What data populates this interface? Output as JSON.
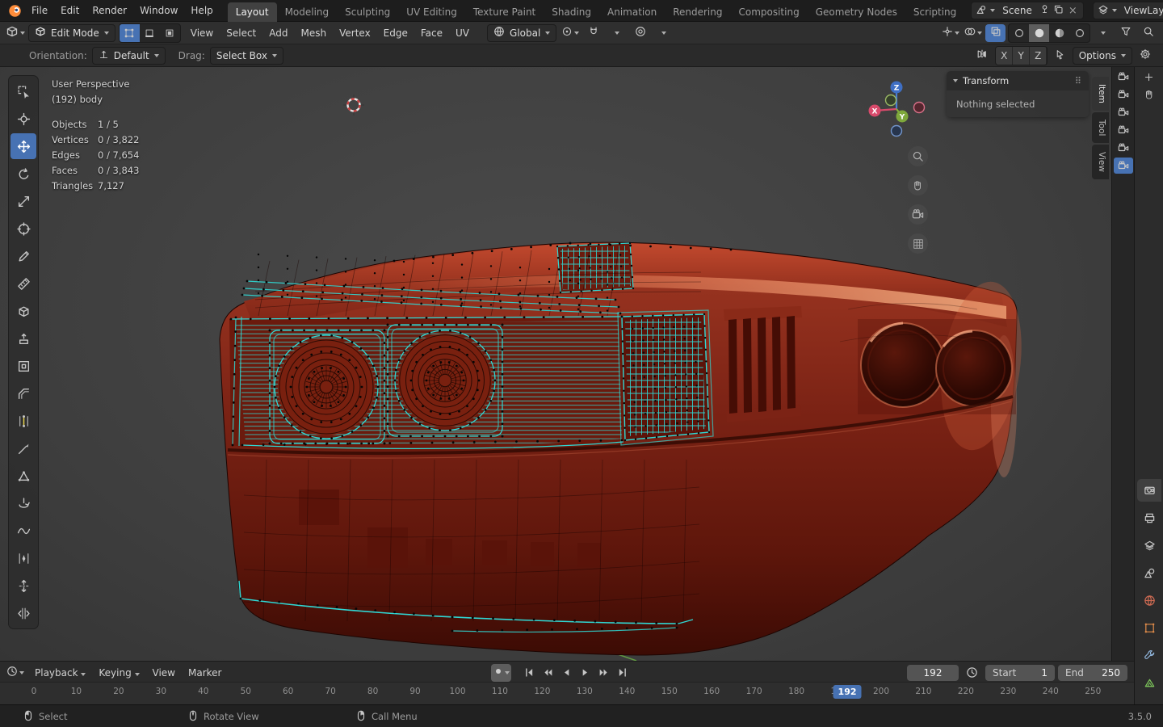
{
  "topbar": {
    "menus": [
      "File",
      "Edit",
      "Render",
      "Window",
      "Help"
    ],
    "workspaces": [
      "Layout",
      "Modeling",
      "Sculpting",
      "UV Editing",
      "Texture Paint",
      "Shading",
      "Animation",
      "Rendering",
      "Compositing",
      "Geometry Nodes",
      "Scripting"
    ],
    "active_workspace": "Layout",
    "scene_selector": {
      "label": "Scene"
    },
    "viewlayer_selector": {
      "label": "ViewLayer"
    }
  },
  "viewport_header": {
    "mode_selector": "Edit Mode",
    "select_modes": [
      "vertex",
      "edge",
      "face"
    ],
    "active_select_mode": "vertex",
    "menus": [
      "View",
      "Select",
      "Add",
      "Mesh",
      "Vertex",
      "Edge",
      "Face",
      "UV"
    ],
    "orientation": "Global",
    "shading_modes": [
      "wireframe",
      "solid",
      "material",
      "rendered"
    ],
    "active_shading_mode": "solid"
  },
  "tool_settings_bar": {
    "orientation_label": "Orientation:",
    "orientation_value": "Default",
    "drag_label": "Drag:",
    "drag_value": "Select Box",
    "axis_toggles": [
      "X",
      "Y",
      "Z"
    ],
    "options_label": "Options"
  },
  "toolbar_tools": [
    "select-box",
    "cursor",
    "move",
    "rotate",
    "scale",
    "transform",
    "annotate",
    "measure",
    "add-cube",
    "extrude-region",
    "inset-faces",
    "bevel",
    "loop-cut",
    "knife",
    "poly-build",
    "spin",
    "smooth",
    "edge-slide",
    "shrink-fatten",
    "rip-region"
  ],
  "active_tool": "move",
  "viewport": {
    "perspective_label": "User Perspective",
    "object_label": "(192) body",
    "stats": [
      {
        "label": "Objects",
        "value": "1 / 5"
      },
      {
        "label": "Vertices",
        "value": "0 / 3,822"
      },
      {
        "label": "Edges",
        "value": "0 / 7,654"
      },
      {
        "label": "Faces",
        "value": "0 / 3,843"
      },
      {
        "label": "Triangles",
        "value": "7,127"
      }
    ],
    "gizmo_axes": [
      "X",
      "Y",
      "Z"
    ],
    "sidebar_tabs": [
      "Item",
      "Tool",
      "View"
    ],
    "active_sidebar_tab": "Item",
    "transform_panel": {
      "title": "Transform",
      "message": "Nothing selected"
    }
  },
  "right_rail": {
    "outliner_camera_toggles": 6,
    "properties_tabs": [
      "render",
      "output",
      "view-layer",
      "scene",
      "world",
      "object",
      "modifiers",
      "data"
    ],
    "active_properties_tab": "render"
  },
  "timeline": {
    "menus": [
      "Playback",
      "Keying",
      "View",
      "Marker"
    ],
    "transport": [
      "jump-start",
      "prev-keyframe",
      "play-reverse",
      "play",
      "next-keyframe",
      "jump-end"
    ],
    "current_frame": "192",
    "frame_field_value": "192",
    "start_label": "Start",
    "start_value": "1",
    "end_label": "End",
    "end_value": "250",
    "ticks": [
      "0",
      "10",
      "20",
      "30",
      "40",
      "50",
      "60",
      "70",
      "80",
      "90",
      "100",
      "110",
      "120",
      "130",
      "140",
      "150",
      "160",
      "170",
      "180",
      "190",
      "200",
      "210",
      "220",
      "230",
      "240",
      "250"
    ]
  },
  "statusbar": {
    "items": [
      {
        "icon": "mouse-left",
        "label": "Select"
      },
      {
        "icon": "mouse-middle",
        "label": "Rotate View"
      },
      {
        "icon": "mouse-right",
        "label": "Call Menu"
      }
    ],
    "version": "3.5.0"
  },
  "colors": {
    "accent": "#4772b3",
    "selection": "#2fd8d4",
    "body_paint": "#7c2315"
  }
}
